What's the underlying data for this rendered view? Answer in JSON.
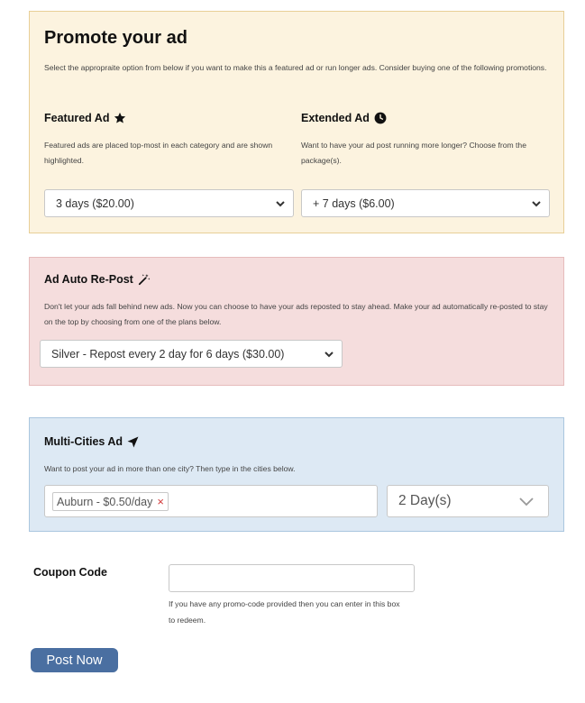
{
  "promote": {
    "title": "Promote your ad",
    "description": "Select the appropraite option from below if you want to make this a featured ad or run longer ads. Consider buying one of the following promotions.",
    "featured": {
      "title": "Featured Ad",
      "icon": "star-icon",
      "description": "Featured ads are placed top-most in each category and are shown highlighted.",
      "selected": "3 days ($20.00)"
    },
    "extended": {
      "title": "Extended Ad",
      "icon": "clock-icon",
      "description": "Want to have your ad post running more longer? Choose from the package(s).",
      "selected": "+ 7 days ($6.00)"
    }
  },
  "repost": {
    "title": "Ad Auto Re-Post",
    "icon": "magic-wand-icon",
    "description": "Don't let your ads fall behind new ads. Now you can choose to have your ads reposted to stay ahead. Make your ad automatically re-posted to stay on the top by choosing from one of the plans below.",
    "selected": "Silver - Repost every 2 day for 6 days ($30.00)"
  },
  "multi": {
    "title": "Multi-Cities Ad",
    "icon": "location-arrow-icon",
    "description": "Want to post your ad in more than one city? Then type in the cities below.",
    "tag": "Auburn - $0.50/day",
    "tag_remove": "×",
    "days_selected": "2 Day(s)"
  },
  "coupon": {
    "label": "Coupon Code",
    "value": "",
    "help": "If you have any promo-code provided then you can enter in this box to redeem."
  },
  "submit_label": "Post Now"
}
